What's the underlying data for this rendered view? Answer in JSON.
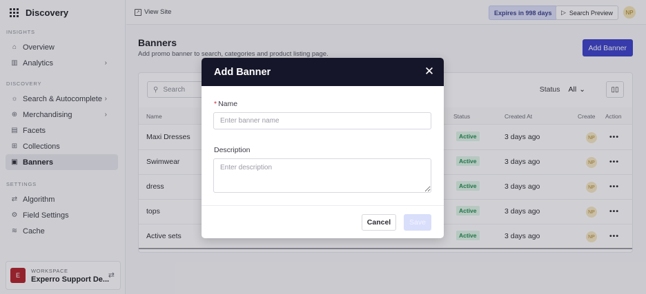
{
  "colors": {
    "accent": "#3a3fc9",
    "modal_header": "#16162a",
    "active_badge_bg": "#dff5e7",
    "active_badge_text": "#1f8a4c",
    "required": "#d0283a"
  },
  "brand": {
    "icon": "apps-grid-icon",
    "title": "Discovery"
  },
  "sidebar": {
    "insights_label": "INSIGHTS",
    "insights": [
      {
        "label": "Overview",
        "icon": "home-icon"
      },
      {
        "label": "Analytics",
        "icon": "analytics-icon",
        "has_chevron": true
      }
    ],
    "discovery_label": "DISCOVERY",
    "discovery": [
      {
        "label": "Search & Autocomplete",
        "icon": "lightbulb-icon",
        "has_chevron": true
      },
      {
        "label": "Merchandising",
        "icon": "search-zoom-icon",
        "has_chevron": true
      },
      {
        "label": "Facets",
        "icon": "facets-icon"
      },
      {
        "label": "Collections",
        "icon": "collections-icon"
      },
      {
        "label": "Banners",
        "icon": "banner-icon",
        "active": true
      }
    ],
    "settings_label": "SETTINGS",
    "settings": [
      {
        "label": "Algorithm",
        "icon": "algorithm-icon"
      },
      {
        "label": "Field Settings",
        "icon": "gear-icon"
      },
      {
        "label": "Cache",
        "icon": "database-icon"
      }
    ]
  },
  "workspace": {
    "avatar_letter": "E",
    "label": "WORKSPACE",
    "name": "Experro Support De..."
  },
  "topbar": {
    "view_site": "View Site",
    "expires": "Expires in 998 days",
    "search_preview": "Search Preview",
    "user_initials": "NP"
  },
  "page": {
    "title": "Banners",
    "subtitle": "Add promo banner to search, categories and product listing page.",
    "add_button": "Add Banner"
  },
  "table": {
    "search_placeholder": "Search",
    "status_label": "Status",
    "status_value": "All",
    "headers": {
      "name": "Name",
      "status": "Status",
      "created_at": "Created At",
      "created_by": "Create",
      "action": "Action"
    },
    "rows": [
      {
        "name": "Maxi Dresses",
        "status": "Active",
        "created_at": "3 days ago",
        "creator": "NP",
        "action": "•••"
      },
      {
        "name": "Swimwear",
        "status": "Active",
        "created_at": "3 days ago",
        "creator": "NP",
        "action": "•••"
      },
      {
        "name": "dress",
        "status": "Active",
        "created_at": "3 days ago",
        "creator": "NP",
        "action": "•••"
      },
      {
        "name": "tops",
        "status": "Active",
        "created_at": "3 days ago",
        "creator": "NP",
        "action": "•••"
      },
      {
        "name": "Active sets",
        "status": "Active",
        "created_at": "3 days ago",
        "creator": "NP",
        "action": "•••"
      }
    ]
  },
  "modal": {
    "title": "Add Banner",
    "name_label": "Name",
    "name_required_mark": "*",
    "name_placeholder": "Enter banner name",
    "description_label": "Description",
    "description_placeholder": "Enter description",
    "cancel": "Cancel",
    "save": "Save"
  }
}
